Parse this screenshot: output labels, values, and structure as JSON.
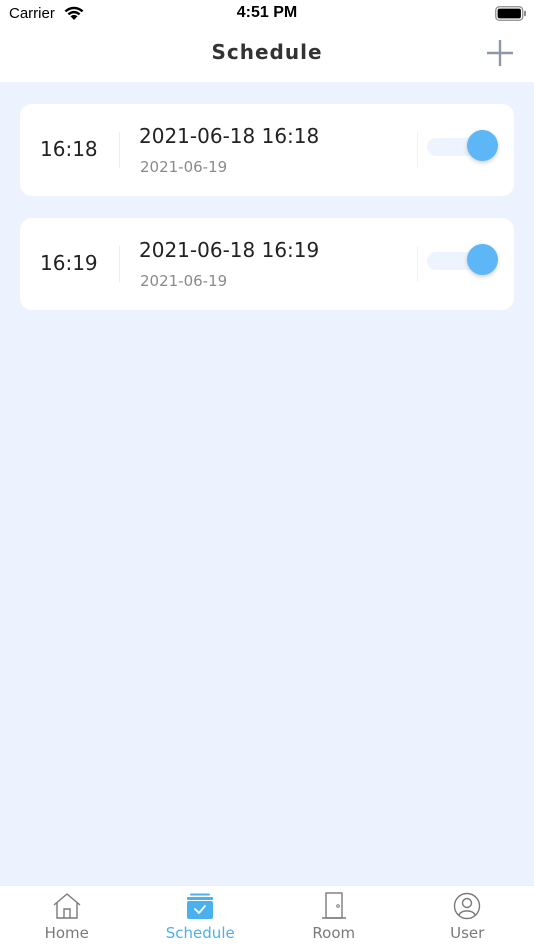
{
  "status_bar": {
    "carrier": "Carrier",
    "time": "4:51 PM"
  },
  "nav": {
    "title": "Schedule"
  },
  "schedules": [
    {
      "time": "16:18",
      "title": "2021-06-18 16:18",
      "date": "2021-06-19",
      "enabled": true
    },
    {
      "time": "16:19",
      "title": "2021-06-18 16:19",
      "date": "2021-06-19",
      "enabled": true
    }
  ],
  "tabs": [
    {
      "label": "Home",
      "icon": "home-icon",
      "active": false
    },
    {
      "label": "Schedule",
      "icon": "schedule-icon",
      "active": true
    },
    {
      "label": "Room",
      "icon": "door-icon",
      "active": false
    },
    {
      "label": "User",
      "icon": "user-icon",
      "active": false
    }
  ],
  "colors": {
    "accent": "#4bb0ee",
    "toggle_on": "#5db6f5",
    "background": "#ecf3fe",
    "card": "#ffffff",
    "inactive_tab": "#7a7a7a"
  }
}
